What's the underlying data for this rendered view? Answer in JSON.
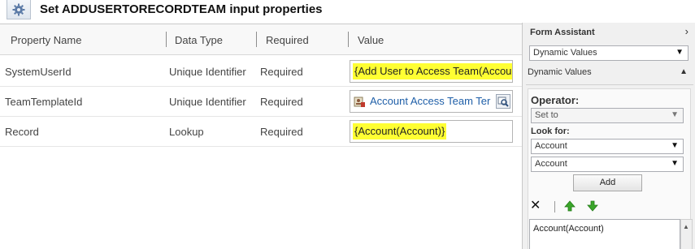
{
  "dialog": {
    "title": "Set ADDUSERTORECORDTEAM input properties"
  },
  "table": {
    "columns": [
      "Property Name",
      "Data Type",
      "Required",
      "Value"
    ],
    "rows": [
      {
        "name": "SystemUserId",
        "type": "Unique Identifier",
        "required": "Required",
        "value": "{Add User to Access Team(Accoun"
      },
      {
        "name": "TeamTemplateId",
        "type": "Unique Identifier",
        "required": "Required",
        "value": "Account Access Team Ter"
      },
      {
        "name": "Record",
        "type": "Lookup",
        "required": "Required",
        "value": "{Account(Account)}"
      }
    ]
  },
  "assistant": {
    "title": "Form Assistant",
    "mode_select": "Dynamic Values",
    "section_label": "Dynamic Values",
    "operator_label": "Operator:",
    "operator_value": "Set to",
    "look_for_label": "Look for:",
    "look_for_entity": "Account",
    "look_for_attribute": "Account",
    "add_button": "Add",
    "selected_values": [
      "Account(Account)"
    ]
  },
  "icons": {
    "title": "gear-icon",
    "lookup_record": "record-icon",
    "lookup_search": "search-icon",
    "remove": "close-icon",
    "move_up": "arrow-up-icon",
    "move_down": "arrow-down-icon"
  },
  "colors": {
    "highlight": "#ffff33",
    "lookup_link": "#1f5fa8",
    "arrow_green": "#3aa62a",
    "assistant_bg": "#f0f0f0"
  }
}
